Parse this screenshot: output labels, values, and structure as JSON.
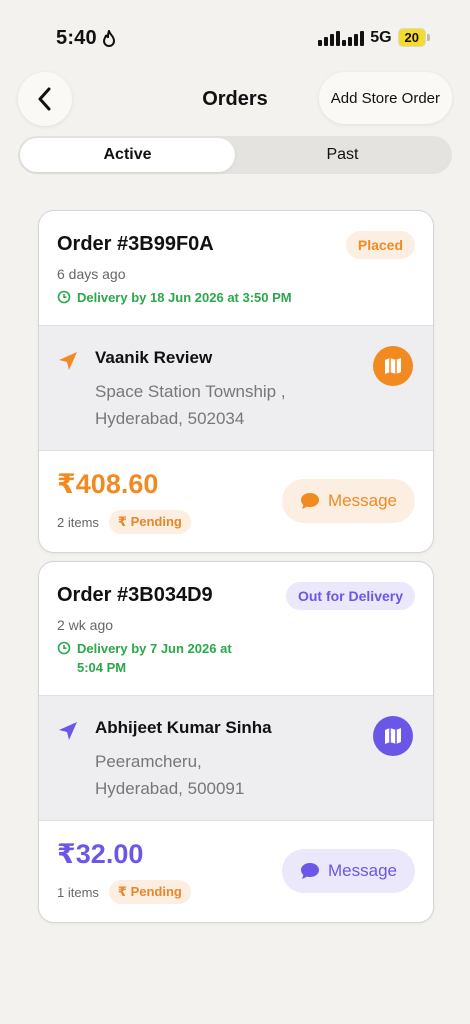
{
  "status_bar": {
    "time": "5:40",
    "network": "5G",
    "battery": "20"
  },
  "header": {
    "title": "Orders",
    "add_label": "Add Store Order"
  },
  "tabs": [
    {
      "label": "Active",
      "active": true
    },
    {
      "label": "Past",
      "active": false
    }
  ],
  "colors": {
    "orange": "#f28a22",
    "purple": "#6a57e8",
    "green": "#2aa84a"
  },
  "orders": [
    {
      "id": "Order #3B99F0A",
      "status": "Placed",
      "ago": "6 days ago",
      "delivery": "Delivery by 18 Jun 2026 at 3:50 PM",
      "name": "Vaanik Review",
      "address_line1": "Space Station Township ,",
      "address_line2": "Hyderabad, 502034",
      "amount": "₹408.60",
      "items": "2 items",
      "payment": "₹ Pending",
      "message_label": "Message"
    },
    {
      "id": "Order #3B034D9",
      "status": "Out for Delivery",
      "ago": "2 wk ago",
      "delivery": "Delivery by 7 Jun 2026 at 5:04 PM",
      "name": "Abhijeet Kumar Sinha",
      "address_line1": "Peeramcheru,",
      "address_line2": "Hyderabad, 500091",
      "amount": "₹32.00",
      "items": "1 items",
      "payment": "₹ Pending",
      "message_label": "Message"
    }
  ]
}
